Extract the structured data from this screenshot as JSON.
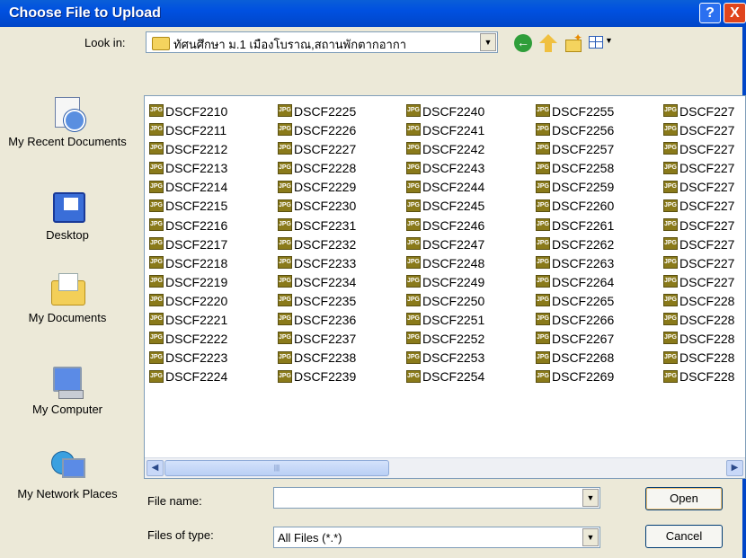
{
  "window": {
    "title": "Choose File to Upload",
    "help_glyph": "?",
    "close_glyph": "X"
  },
  "lookin": {
    "label": "Look in:",
    "folder": "ทัศนศึกษา ม.1 เมืองโบราณ,สถานพักตากอากา"
  },
  "places": [
    {
      "label": "My Recent Documents",
      "icon": "recent-documents-icon"
    },
    {
      "label": "Desktop",
      "icon": "desktop-icon"
    },
    {
      "label": "My Documents",
      "icon": "my-documents-icon"
    },
    {
      "label": "My Computer",
      "icon": "my-computer-icon"
    },
    {
      "label": "My Network Places",
      "icon": "network-places-icon"
    }
  ],
  "files": {
    "icon_label": "JPG",
    "columns": [
      [
        "DSCF2210",
        "DSCF2211",
        "DSCF2212",
        "DSCF2213",
        "DSCF2214",
        "DSCF2215",
        "DSCF2216",
        "DSCF2217",
        "DSCF2218",
        "DSCF2219",
        "DSCF2220",
        "DSCF2221",
        "DSCF2222",
        "DSCF2223",
        "DSCF2224"
      ],
      [
        "DSCF2225",
        "DSCF2226",
        "DSCF2227",
        "DSCF2228",
        "DSCF2229",
        "DSCF2230",
        "DSCF2231",
        "DSCF2232",
        "DSCF2233",
        "DSCF2234",
        "DSCF2235",
        "DSCF2236",
        "DSCF2237",
        "DSCF2238",
        "DSCF2239"
      ],
      [
        "DSCF2240",
        "DSCF2241",
        "DSCF2242",
        "DSCF2243",
        "DSCF2244",
        "DSCF2245",
        "DSCF2246",
        "DSCF2247",
        "DSCF2248",
        "DSCF2249",
        "DSCF2250",
        "DSCF2251",
        "DSCF2252",
        "DSCF2253",
        "DSCF2254"
      ],
      [
        "DSCF2255",
        "DSCF2256",
        "DSCF2257",
        "DSCF2258",
        "DSCF2259",
        "DSCF2260",
        "DSCF2261",
        "DSCF2262",
        "DSCF2263",
        "DSCF2264",
        "DSCF2265",
        "DSCF2266",
        "DSCF2267",
        "DSCF2268",
        "DSCF2269"
      ],
      [
        "DSCF227",
        "DSCF227",
        "DSCF227",
        "DSCF227",
        "DSCF227",
        "DSCF227",
        "DSCF227",
        "DSCF227",
        "DSCF227",
        "DSCF227",
        "DSCF228",
        "DSCF228",
        "DSCF228",
        "DSCF228",
        "DSCF228"
      ]
    ]
  },
  "form": {
    "file_name_label": "File name:",
    "file_name_value": "",
    "file_type_label": "Files of type:",
    "file_type_value": "All Files (*.*)",
    "open_label": "Open",
    "cancel_label": "Cancel"
  },
  "colors": {
    "titlebar": "#0054e3",
    "dialog_bg": "#ece9d8",
    "close": "#e0441c"
  }
}
